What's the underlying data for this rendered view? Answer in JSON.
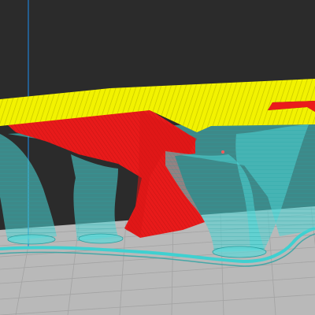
{
  "viewport": {
    "kind": "3d-slicer-layer-preview",
    "background_color": "#2b2b2b",
    "build_plate_color": "#b9b9b9",
    "grid_line_color": "#a3a3a3",
    "axis_line_color": "#1f7fd0"
  },
  "features": {
    "top_solid_infill": {
      "color": "#f2f200",
      "edge_color": "#c9c900"
    },
    "overhang_perimeter": {
      "color": "#ea1b1b",
      "dark_color": "#b81212"
    },
    "support_material": {
      "color": "#46d3d3",
      "shadow_color": "#2aa3a3"
    },
    "skirt": {
      "color": "#3fd0d0"
    }
  }
}
